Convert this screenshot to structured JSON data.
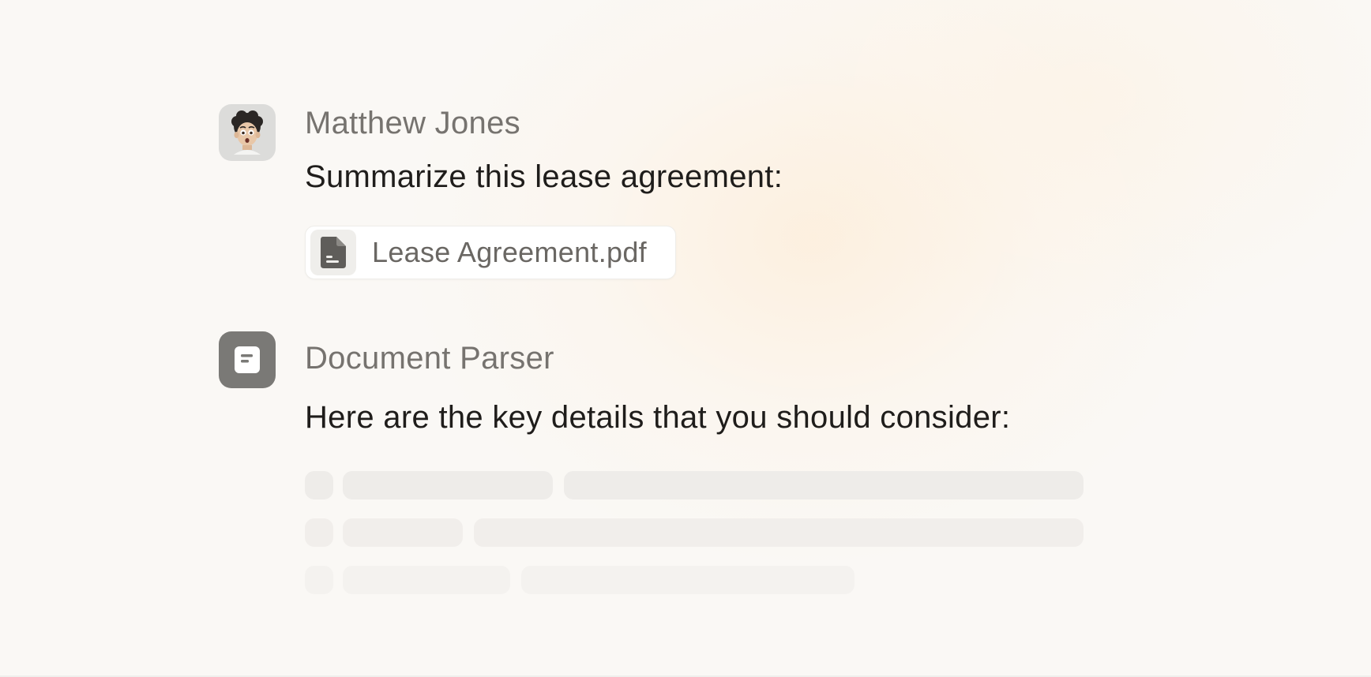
{
  "conversation": {
    "user": {
      "name": "Matthew Jones",
      "avatar_icon": "memoji-avatar-icon",
      "message": "Summarize this lease agreement:",
      "attachment": {
        "icon": "document-file-icon",
        "file_name": "Lease Agreement.pdf"
      }
    },
    "assistant": {
      "name": "Document Parser",
      "avatar_icon": "document-parser-icon",
      "message": "Here are the key details that you should consider:",
      "loading_rows": 3
    }
  },
  "colors": {
    "user_avatar_bg": "#dcdcda",
    "assistant_avatar_bg": "#7a7976",
    "skeleton": "#eeece9",
    "text_primary": "#1f1d1b",
    "text_secondary": "#76736f"
  }
}
